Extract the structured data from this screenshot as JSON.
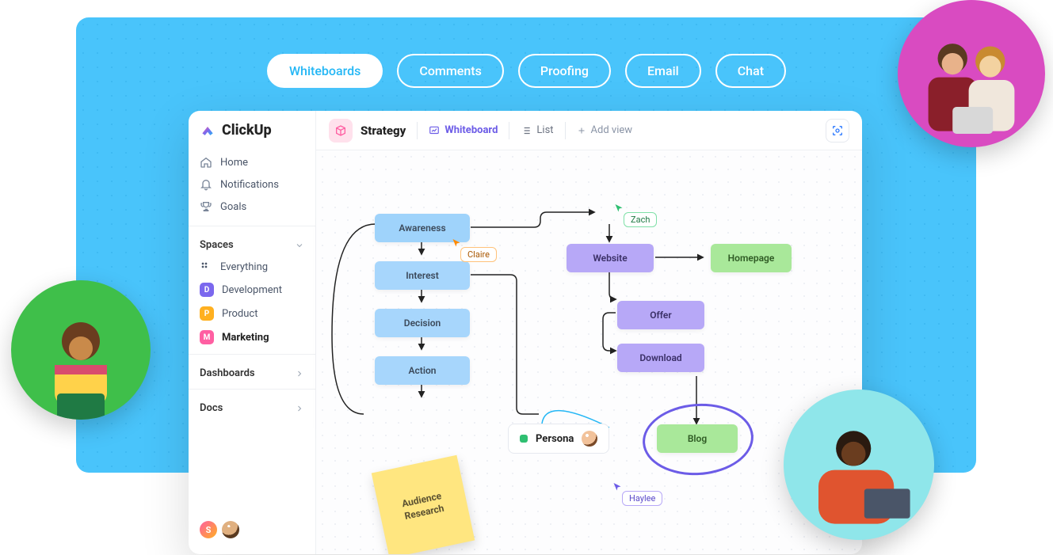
{
  "tabs": {
    "whiteboards": "Whiteboards",
    "comments": "Comments",
    "proofing": "Proofing",
    "email": "Email",
    "chat": "Chat"
  },
  "brand": "ClickUp",
  "nav": {
    "home": "Home",
    "notifications": "Notifications",
    "goals": "Goals"
  },
  "spaces": {
    "header": "Spaces",
    "everything": "Everything",
    "items": [
      {
        "letter": "D",
        "label": "Development",
        "color": "#7b68ee"
      },
      {
        "letter": "P",
        "label": "Product",
        "color": "#ffb020"
      },
      {
        "letter": "M",
        "label": "Marketing",
        "color": "#ff5fa2",
        "active": true
      }
    ]
  },
  "dashboards": "Dashboards",
  "docs": "Docs",
  "topbar": {
    "title": "Strategy",
    "whiteboard": "Whiteboard",
    "list": "List",
    "addview": "Add view"
  },
  "nodes": {
    "awareness": "Awareness",
    "interest": "Interest",
    "decision": "Decision",
    "action": "Action",
    "website": "Website",
    "offer": "Offer",
    "download": "Download",
    "homepage": "Homepage",
    "blog": "Blog",
    "persona": "Persona",
    "sticky": "Audience Research"
  },
  "cursors": {
    "zach": "Zach",
    "claire": "Claire",
    "haylee": "Haylee"
  },
  "collab_colors": [
    "#2fbf71",
    "#2f7bff",
    "#ff8a00"
  ]
}
